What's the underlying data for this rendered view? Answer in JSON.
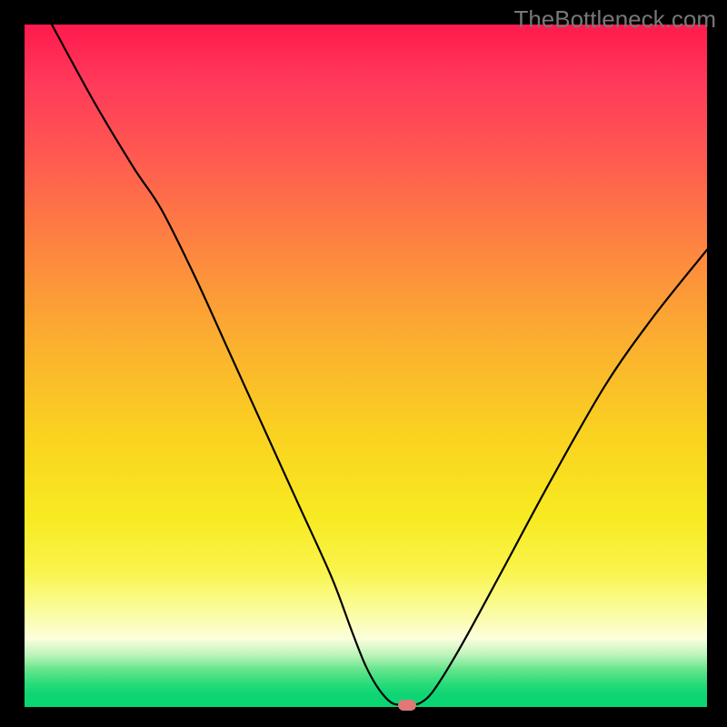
{
  "watermark": "TheBottleneck.com",
  "chart_data": {
    "type": "line",
    "title": "",
    "xlabel": "",
    "ylabel": "",
    "xlim": [
      0,
      100
    ],
    "ylim": [
      0,
      100
    ],
    "gradient": "red-to-green",
    "series": [
      {
        "name": "curve",
        "x": [
          4,
          10,
          16,
          20,
          25,
          30,
          35,
          40,
          45,
          48,
          50,
          52,
          54,
          56.5,
          58,
          60,
          64,
          70,
          77,
          85,
          92,
          100
        ],
        "values": [
          100,
          89,
          79,
          73,
          63,
          52,
          41,
          30,
          19,
          11,
          6,
          2.5,
          0.5,
          0.4,
          0.6,
          2.5,
          9,
          20,
          33,
          47,
          57,
          67
        ]
      }
    ],
    "marker": {
      "x": 56,
      "y": 0.3
    },
    "flat_segment": {
      "x0": 50.5,
      "x1": 56.5,
      "y": 0.4
    }
  }
}
